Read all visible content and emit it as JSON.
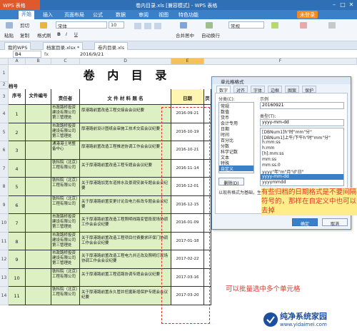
{
  "window": {
    "app_button": "WPS 表格",
    "title": "卷内目录.xls [兼容模式] - WPS 表格"
  },
  "menu": {
    "items": [
      "开始",
      "插入",
      "页面布局",
      "公式",
      "数据",
      "审阅",
      "视图",
      "特色功能"
    ],
    "active": "开始",
    "login": "未登录"
  },
  "ribbon": {
    "cut": "剪切",
    "paste": "粘贴",
    "copy": "复制",
    "format_painter": "格式刷",
    "font_name": "宋体",
    "font_size": "10",
    "merge_center": "合并居中",
    "wrap": "自动换行",
    "general": "常规"
  },
  "tabs": [
    "我的WPS",
    "档案目录.xlsx *",
    "卷内目录.xls"
  ],
  "formula_bar": {
    "cell_ref": "B4",
    "fx": "fx",
    "value": "2016/9/21"
  },
  "columns": [
    "A",
    "B",
    "C",
    "D",
    "E",
    "F"
  ],
  "sheet": {
    "title": "卷 内 目 录",
    "dang_hao": "档号",
    "headers": {
      "seq": "序号",
      "file_no": "文件编号",
      "responsible": "责任者",
      "title": "文 件 材 料 题 名",
      "date": "日期",
      "page": "页"
    },
    "rows": [
      {
        "row": "4",
        "seq": "1",
        "org": "市政路桥投资建设有限公司第三管理处",
        "title": "厚港路前置改造工程交接会会议纪要",
        "date": "2016-09-21"
      },
      {
        "row": "5",
        "seq": "2",
        "org": "市政路桥投资建设有限公司第三管理处",
        "title": "厚港路前设计图纸会审施工技术交底会议纪要",
        "date": "2016-10-19"
      },
      {
        "row": "6",
        "seq": "3",
        "org": "通港港土地整备中心",
        "title": "厚港路前置改造工程推进协调工作会会议纪要",
        "date": "2016-10-21"
      },
      {
        "row": "7",
        "seq": "4",
        "org": "铁科院（北京）工程有限公司",
        "title": "关于厚港路前置改造工程专题会会议纪要",
        "date": "2016-11-14"
      },
      {
        "row": "8",
        "seq": "5",
        "org": "铁科院（北京）工程有限公司",
        "title": "关于厚港路加宽车道排水及景观安装专题会会议纪要",
        "date": "2016-12-01"
      },
      {
        "row": "9",
        "seq": "6",
        "org": "铁科院（北京）工程有限公司",
        "title": "关于厚港路前置变更讨论及电力拆改专题会会议纪要",
        "date": "2016-12-15"
      },
      {
        "row": "10",
        "seq": "7",
        "org": "市政路桥投资建设有限公司第三管理处",
        "title": "关于厚港路前置改造工程照明线路变管段现场协调工作会会议纪要",
        "date": "2016-01-09"
      },
      {
        "row": "11",
        "seq": "8",
        "org": "市政路桥投资建设有限公司第三管理处",
        "title": "关于厚港路前置改造工程项目付费要求环保门协调工作会会议纪要",
        "date": "2017-01-18"
      },
      {
        "row": "12",
        "seq": "9",
        "org": "市政路桥投资建设有限公司第三管理处",
        "title": "关于厚港路前置改造工程电力井迁改及照明灯现场协调工作会会议纪要",
        "date": "2017-02-22"
      },
      {
        "row": "13",
        "seq": "10",
        "org": "铁科院（北京）工程有限公司",
        "title": "关于厚港路前置工程道路协调专题会会议纪要",
        "date": "2017-03-16"
      },
      {
        "row": "14",
        "seq": "11",
        "org": "铁科院（北京）工程有限公司",
        "title": "关于厚港路前置永久管井挖掘新增保护专题会会议纪要",
        "date": "2017-03-20"
      }
    ],
    "row_numbers": [
      "1",
      "2",
      "3"
    ]
  },
  "dialog": {
    "title": "单元格格式",
    "tabs": [
      "数字",
      "对齐",
      "字体",
      "边框",
      "图案",
      "保护"
    ],
    "active_tab": "数字",
    "category_label": "分类(C):",
    "categories": [
      "常规",
      "数值",
      "货币",
      "会计专用",
      "日期",
      "时间",
      "百分比",
      "分数",
      "科学记数",
      "文本",
      "特殊",
      "自定义"
    ],
    "selected_category": "自定义",
    "sample_label": "示例",
    "sample_value": "20160921",
    "type_label": "类型(T):",
    "type_value": "yyyy-mm-dd",
    "type_list": [
      "[DBNum1]h\"时\"mm\"分\"",
      "[DBNum1]上午/下午h\"时\"mm\"分\"",
      "h:mm:ss",
      "h:mm",
      "[h]:mm:ss",
      "mm:ss",
      "mm:ss.0",
      "yyyy\"年\"m\"月\"d\"日\"",
      "yyyy-mm-dd",
      "yyyymmdd"
    ],
    "delete_label": "删除(D)",
    "base_text": "以现有格式为基础，生成自定义的数字格式。",
    "ok": "确定",
    "cancel": "取消"
  },
  "annotations": {
    "note1": "有些归档的日期格式是不要间隔符号的，那样在自定义中也可以去掉",
    "note2": "可以批量选中多个单元格"
  },
  "watermark": {
    "name": "纯净系统家园",
    "url": "www.yidaimei.com"
  }
}
